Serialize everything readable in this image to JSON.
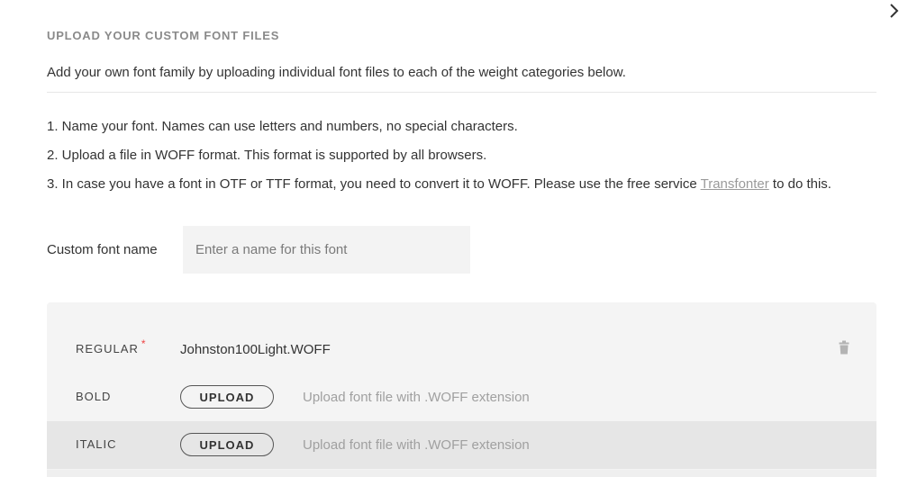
{
  "title": "UPLOAD YOUR CUSTOM FONT FILES",
  "intro": "Add your own font family by uploading individual font files to each of the weight categories below.",
  "steps": [
    {
      "text": "1. Name your font. Names can use letters and numbers, no special characters."
    },
    {
      "text": "2. Upload a file in WOFF format. This format is supported by all browsers."
    },
    {
      "text_before": "3. In case you have a font in OTF or TTF format, you need to convert it to WOFF. Please use the free service ",
      "link": "Transfonter",
      "text_after": " to do this."
    }
  ],
  "name_field": {
    "label": "Custom font name",
    "placeholder": "Enter a name for this font",
    "value": ""
  },
  "weights": [
    {
      "label": "REGULAR",
      "required_mark": "*",
      "file": "Johnston100Light.WOFF"
    },
    {
      "label": "BOLD",
      "button": "UPLOAD",
      "hint": "Upload font file with .WOFF extension"
    },
    {
      "label": "ITALIC",
      "button": "UPLOAD",
      "hint": "Upload font file with .WOFF extension"
    }
  ],
  "icons": {
    "close": "close-icon",
    "trash": "trash-icon"
  },
  "colors": {
    "required": "#ee4444",
    "panel_bg": "#f4f4f4",
    "row_alt_bg": "#e6e6e6"
  }
}
